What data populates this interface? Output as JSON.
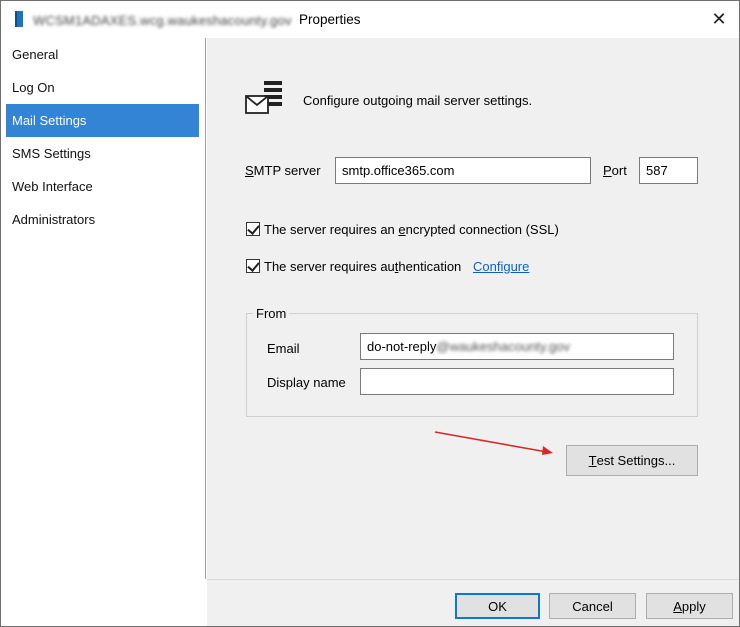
{
  "window": {
    "title_blurred": "WCSM1ADAXES.wcg.waukeshacounty.gov",
    "title_suffix": "Properties"
  },
  "sidebar": {
    "items": [
      {
        "label": "General"
      },
      {
        "label": "Log On"
      },
      {
        "label": "Mail Settings",
        "selected": true
      },
      {
        "label": "SMS Settings"
      },
      {
        "label": "Web Interface"
      },
      {
        "label": "Administrators"
      }
    ]
  },
  "header": {
    "icon": "mail-server-icon",
    "text": "Configure outgoing mail server settings."
  },
  "smtp": {
    "label_first": "S",
    "label_rest": "MTP server",
    "server_value": "smtp.office365.com",
    "port_label_first": "P",
    "port_label_rest": "ort",
    "port_value": "587"
  },
  "options": {
    "ssl_label_pre": "The server requires an ",
    "ssl_label_ul": "e",
    "ssl_label_post": "ncrypted connection (SSL)",
    "ssl_checked": true,
    "auth_label_pre": "The server requires au",
    "auth_label_ul": "t",
    "auth_label_post": "hentication",
    "auth_checked": true,
    "configure_link": "Configure"
  },
  "from": {
    "group_title": "From",
    "email_label": "Email",
    "email_value_visible": "do-not-reply",
    "email_value_blurred": "@waukeshacounty.gov",
    "display_name_label": "Display name",
    "display_name_value": ""
  },
  "test_button": {
    "label_first": "T",
    "label_rest": "est Settings..."
  },
  "footer": {
    "ok_label": "OK",
    "cancel_label": "Cancel",
    "apply_first": "A",
    "apply_rest": "pply"
  },
  "colors": {
    "selected_nav": "#3384d4",
    "link": "#0a63c4",
    "annotation_arrow": "#d42a2a",
    "default_button_border": "#0a78d7"
  }
}
